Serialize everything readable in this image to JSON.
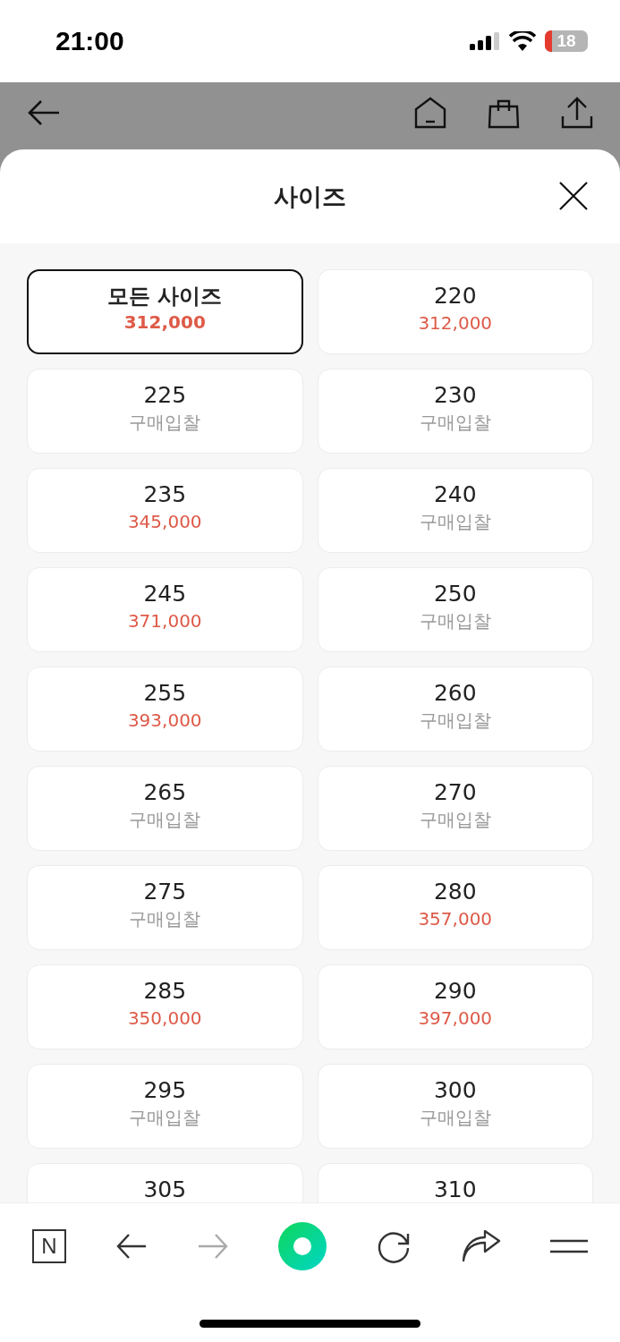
{
  "status_bar": {
    "time": "21:00",
    "battery": "18"
  },
  "sheet": {
    "title": "사이즈"
  },
  "sizes": [
    {
      "label": "모든 사이즈",
      "selected": true,
      "kind": "price",
      "sub": "312,000"
    },
    {
      "label": "220",
      "selected": false,
      "kind": "price",
      "sub": "312,000"
    },
    {
      "label": "225",
      "selected": false,
      "kind": "bid",
      "sub": "구매입찰"
    },
    {
      "label": "230",
      "selected": false,
      "kind": "bid",
      "sub": "구매입찰"
    },
    {
      "label": "235",
      "selected": false,
      "kind": "price",
      "sub": "345,000"
    },
    {
      "label": "240",
      "selected": false,
      "kind": "bid",
      "sub": "구매입찰"
    },
    {
      "label": "245",
      "selected": false,
      "kind": "price",
      "sub": "371,000"
    },
    {
      "label": "250",
      "selected": false,
      "kind": "bid",
      "sub": "구매입찰"
    },
    {
      "label": "255",
      "selected": false,
      "kind": "price",
      "sub": "393,000"
    },
    {
      "label": "260",
      "selected": false,
      "kind": "bid",
      "sub": "구매입찰"
    },
    {
      "label": "265",
      "selected": false,
      "kind": "bid",
      "sub": "구매입찰"
    },
    {
      "label": "270",
      "selected": false,
      "kind": "bid",
      "sub": "구매입찰"
    },
    {
      "label": "275",
      "selected": false,
      "kind": "bid",
      "sub": "구매입찰"
    },
    {
      "label": "280",
      "selected": false,
      "kind": "price",
      "sub": "357,000"
    },
    {
      "label": "285",
      "selected": false,
      "kind": "price",
      "sub": "350,000"
    },
    {
      "label": "290",
      "selected": false,
      "kind": "price",
      "sub": "397,000"
    },
    {
      "label": "295",
      "selected": false,
      "kind": "bid",
      "sub": "구매입찰"
    },
    {
      "label": "300",
      "selected": false,
      "kind": "bid",
      "sub": "구매입찰"
    },
    {
      "label": "305",
      "selected": false
    },
    {
      "label": "310",
      "selected": false
    }
  ],
  "toolbar": {
    "logo": "N",
    "forward_disabled": true
  }
}
